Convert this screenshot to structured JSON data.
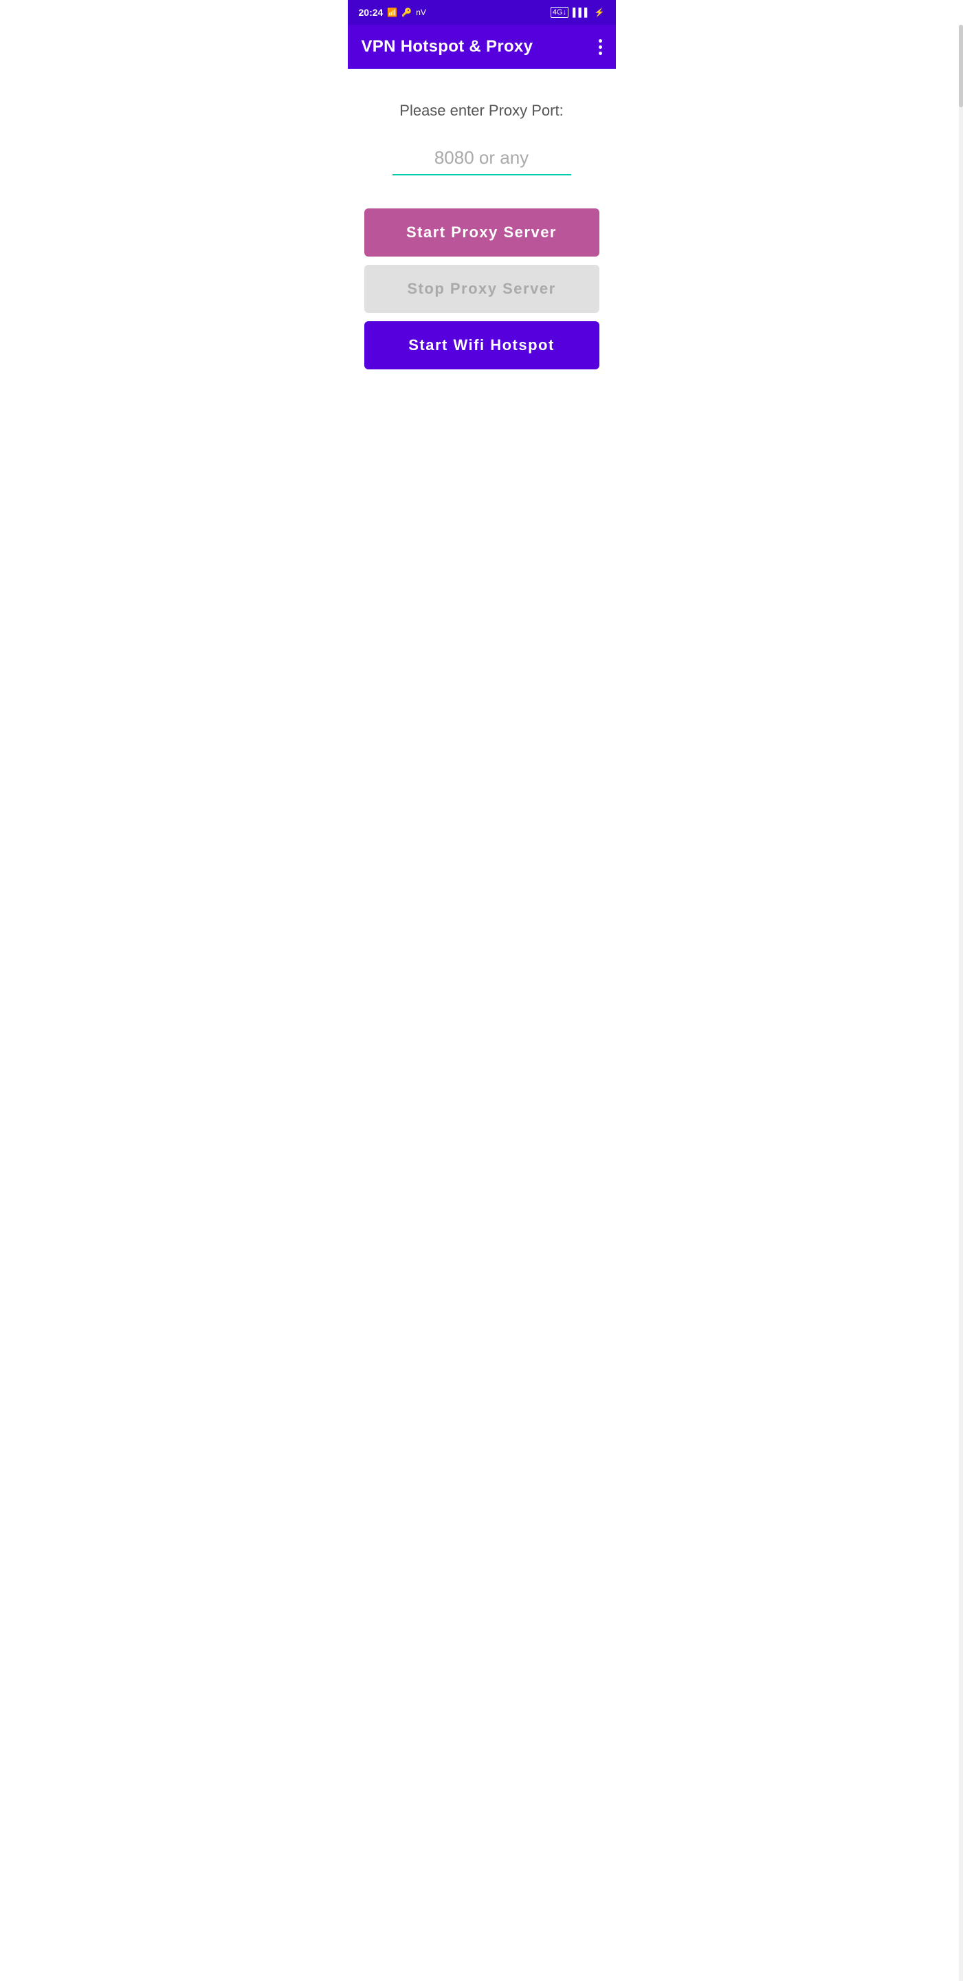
{
  "statusBar": {
    "time": "20:24",
    "icons": {
      "wifi": "wifi",
      "vpn": "vpn-key",
      "nv": "nV",
      "lte": "4G",
      "signal": "signal",
      "battery": "battery"
    }
  },
  "appBar": {
    "title": "VPN Hotspot & Proxy",
    "menuIcon": "⋮"
  },
  "main": {
    "portLabel": "Please enter Proxy Port:",
    "portPlaceholder": "8080 or any",
    "buttons": {
      "startProxy": "Start Proxy Server",
      "stopProxy": "Stop Proxy Server",
      "startHotspot": "Start Wifi Hotspot"
    }
  }
}
